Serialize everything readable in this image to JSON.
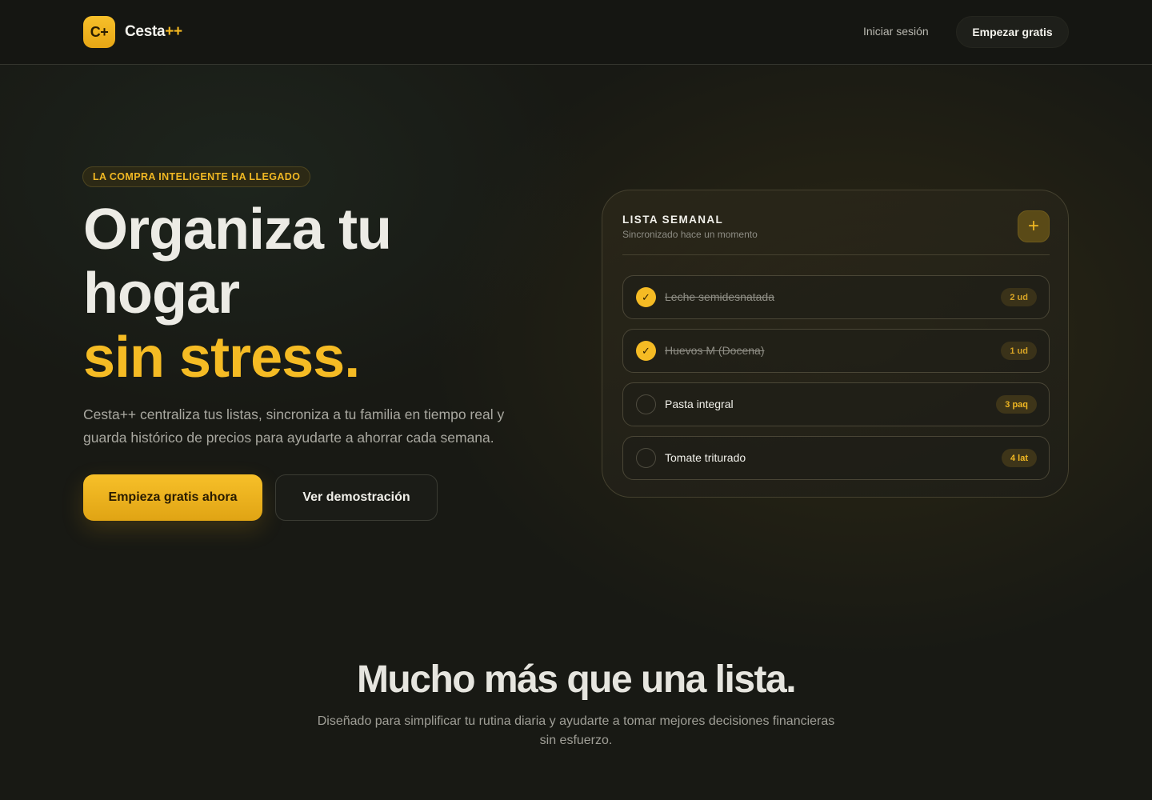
{
  "header": {
    "logo_badge": "C+",
    "brand_name": "Cesta",
    "brand_suffix": "++",
    "login_label": "Iniciar sesión",
    "cta_label": "Empezar gratis"
  },
  "hero": {
    "eyebrow": "LA COMPRA INTELIGENTE HA LLEGADO",
    "title_line1": "Organiza tu",
    "title_line2": "hogar",
    "title_accent": "sin stress.",
    "description": "Cesta++ centraliza tus listas, sincroniza a tu familia en tiempo real y guarda histórico de precios para ayudarte a ahorrar cada semana.",
    "primary_button": "Empieza gratis ahora",
    "secondary_button": "Ver demostración"
  },
  "list_card": {
    "title": "LISTA SEMANAL",
    "subtitle": "Sincronizado hace un momento",
    "add_icon": "+",
    "check_icon": "✓",
    "items": [
      {
        "label": "Leche semidesnatada",
        "qty": "2 ud",
        "done": true
      },
      {
        "label": "Huevos M (Docena)",
        "qty": "1 ud",
        "done": true
      },
      {
        "label": "Pasta integral",
        "qty": "3 paq",
        "done": false
      },
      {
        "label": "Tomate triturado",
        "qty": "4 lat",
        "done": false
      }
    ]
  },
  "features": {
    "title": "Mucho más que una lista.",
    "description": "Diseñado para simplificar tu rutina diaria y ayudarte a tomar mejores decisiones financieras sin esfuerzo."
  },
  "colors": {
    "accent": "#f5bb24",
    "background": "#181914",
    "text": "#ecebe5"
  }
}
